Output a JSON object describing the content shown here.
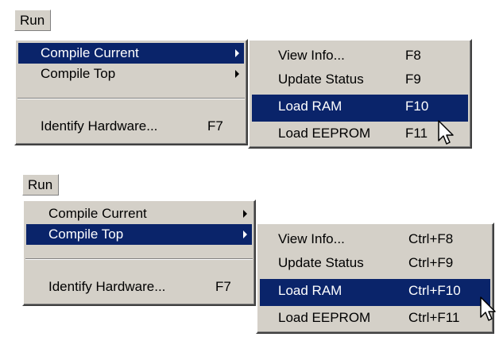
{
  "example1": {
    "menubar": {
      "run_label": "Run"
    },
    "run_menu": {
      "items": [
        {
          "label": "Compile Current",
          "has_submenu": true,
          "highlighted": true
        },
        {
          "label": "Compile Top",
          "has_submenu": true,
          "highlighted": false
        },
        {
          "label": "Identify Hardware...",
          "shortcut": "F7",
          "highlighted": false
        }
      ]
    },
    "submenu": {
      "items": [
        {
          "label": "View Info...",
          "shortcut": "F8",
          "highlighted": false
        },
        {
          "label": "Update Status",
          "shortcut": "F9",
          "highlighted": false
        },
        {
          "label": "Load RAM",
          "shortcut": "F10",
          "highlighted": true
        },
        {
          "label": "Load EEPROM",
          "shortcut": "F11",
          "highlighted": false
        }
      ]
    }
  },
  "example2": {
    "menubar": {
      "run_label": "Run"
    },
    "run_menu": {
      "items": [
        {
          "label": "Compile Current",
          "has_submenu": true,
          "highlighted": false
        },
        {
          "label": "Compile Top",
          "has_submenu": true,
          "highlighted": true
        },
        {
          "label": "Identify Hardware...",
          "shortcut": "F7",
          "highlighted": false
        }
      ]
    },
    "submenu": {
      "items": [
        {
          "label": "View Info...",
          "shortcut": "Ctrl+F8",
          "highlighted": false
        },
        {
          "label": "Update Status",
          "shortcut": "Ctrl+F9",
          "highlighted": false
        },
        {
          "label": "Load RAM",
          "shortcut": "Ctrl+F10",
          "highlighted": true
        },
        {
          "label": "Load EEPROM",
          "shortcut": "Ctrl+F11",
          "highlighted": false
        }
      ]
    }
  },
  "colors": {
    "menu_face": "#d4d0c8",
    "highlight": "#0a246a",
    "highlight_text": "#ffffff"
  },
  "icons": {
    "cursor": "arrow-pointer-icon"
  }
}
